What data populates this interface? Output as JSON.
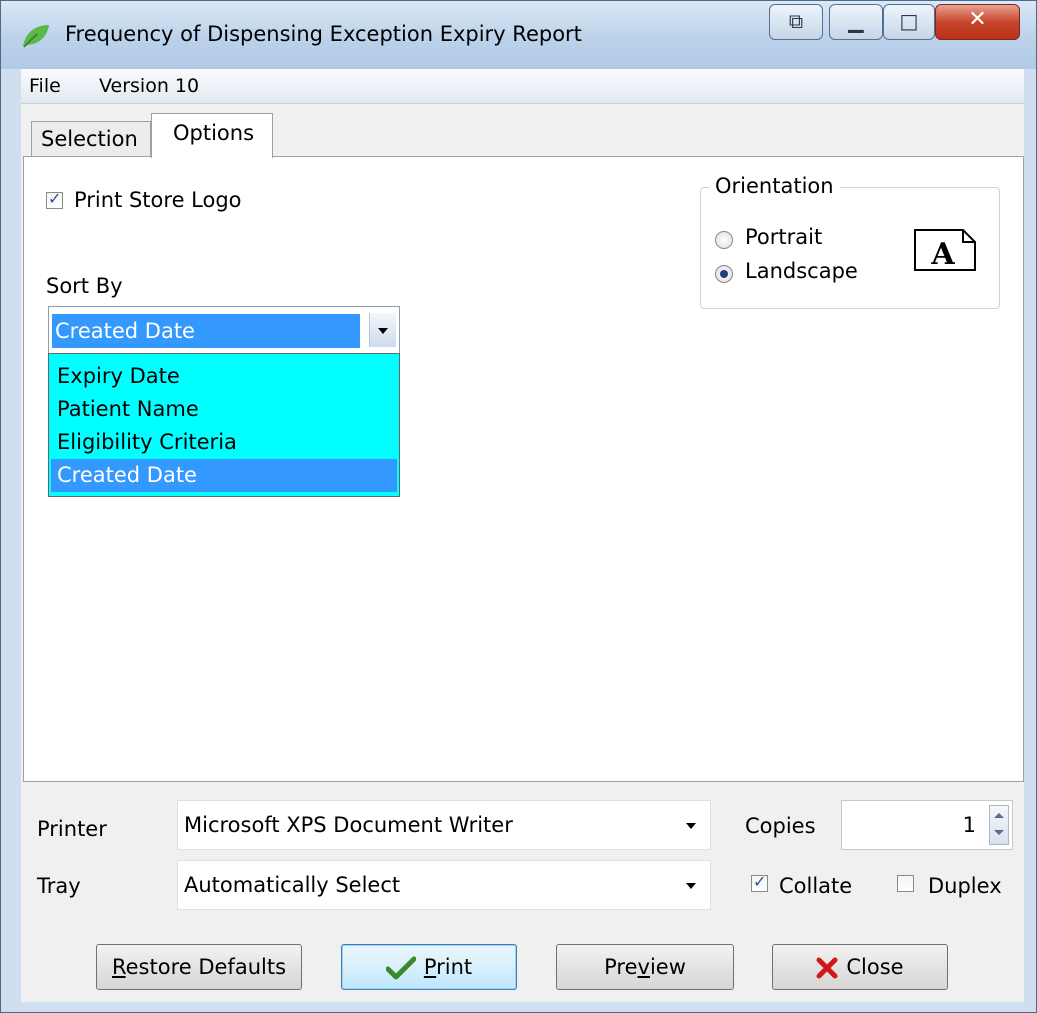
{
  "window": {
    "title": "Frequency of Dispensing Exception Expiry Report"
  },
  "menu": {
    "file": "File",
    "version": "Version 10"
  },
  "tabs": {
    "selection": "Selection",
    "options": "Options"
  },
  "options": {
    "print_logo_label": "Print Store Logo",
    "print_logo_checked": true,
    "sort_by_label": "Sort By",
    "sort_by_value": "Created Date",
    "sort_options": [
      "Expiry Date",
      "Patient Name",
      "Eligibility Criteria",
      "Created Date"
    ],
    "orientation": {
      "legend": "Orientation",
      "portrait": "Portrait",
      "landscape": "Landscape",
      "selected": "Landscape",
      "icon_letter": "A"
    }
  },
  "print": {
    "printer_label": "Printer",
    "printer_value": "Microsoft XPS Document Writer",
    "tray_label": "Tray",
    "tray_value": "Automatically Select",
    "copies_label": "Copies",
    "copies_value": "1",
    "collate_label": "Collate",
    "collate_checked": true,
    "duplex_label": "Duplex",
    "duplex_checked": false
  },
  "buttons": {
    "restore_first": "R",
    "restore_rest": "estore Defaults",
    "print_first": "P",
    "print_rest": "rint",
    "preview_a": "Pre",
    "preview_u": "v",
    "preview_b": "iew",
    "close": "Close"
  },
  "colors": {
    "selection_highlight": "#3399ff",
    "dropdown_bg": "#00ffff",
    "close_caption": "#c7452c"
  }
}
